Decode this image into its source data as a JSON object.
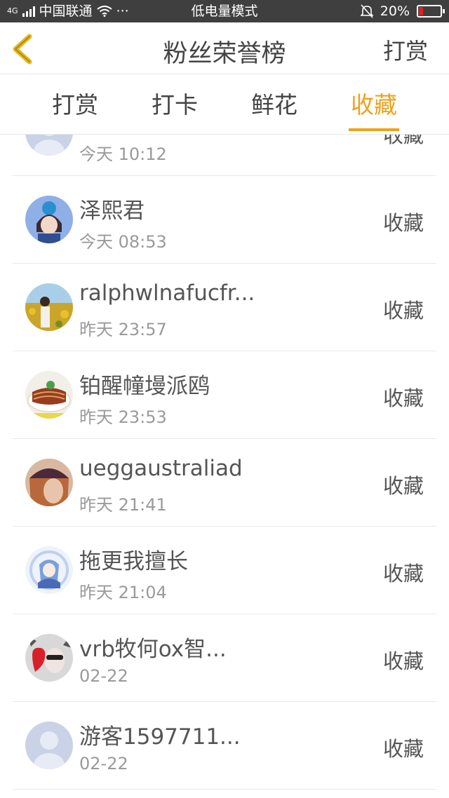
{
  "status_bar": {
    "network": "4G",
    "carrier": "中国联通",
    "more": "···",
    "mode": "低电量模式",
    "battery": "20%",
    "battery_level": 0.2,
    "battery_color": "#e02020"
  },
  "nav": {
    "title": "粉丝荣誉榜",
    "action": "打赏"
  },
  "tabs": [
    {
      "label": "打赏",
      "active": false
    },
    {
      "label": "打卡",
      "active": false
    },
    {
      "label": "鲜花",
      "active": false
    },
    {
      "label": "收藏",
      "active": true
    }
  ],
  "accent_color": "#f0a11a",
  "rows": [
    {
      "name": "",
      "time": "今天 10:12",
      "action": "收藏",
      "avatar": "default-avatar"
    },
    {
      "name": "泽熙君",
      "time": "今天 08:53",
      "action": "收藏",
      "avatar": "anime-avatar"
    },
    {
      "name": "ralphwlnafucfr...",
      "time": "昨天 23:57",
      "action": "收藏",
      "avatar": "sunflower-photo-avatar"
    },
    {
      "name": "铂醒幢墁派鸥",
      "time": "昨天 23:53",
      "action": "收藏",
      "avatar": "food-avatar"
    },
    {
      "name": "ueggaustraliad",
      "time": "昨天 21:41",
      "action": "收藏",
      "avatar": "girl-hat-avatar"
    },
    {
      "name": "拖更我擅长",
      "time": "昨天 21:04",
      "action": "收藏",
      "avatar": "blue-anime-avatar"
    },
    {
      "name": "vrb牧何ox智...",
      "time": "02-22",
      "action": "收藏",
      "avatar": "heart-avatar"
    },
    {
      "name": "游客1597711...",
      "time": "02-22",
      "action": "收藏",
      "avatar": "default-avatar"
    }
  ]
}
